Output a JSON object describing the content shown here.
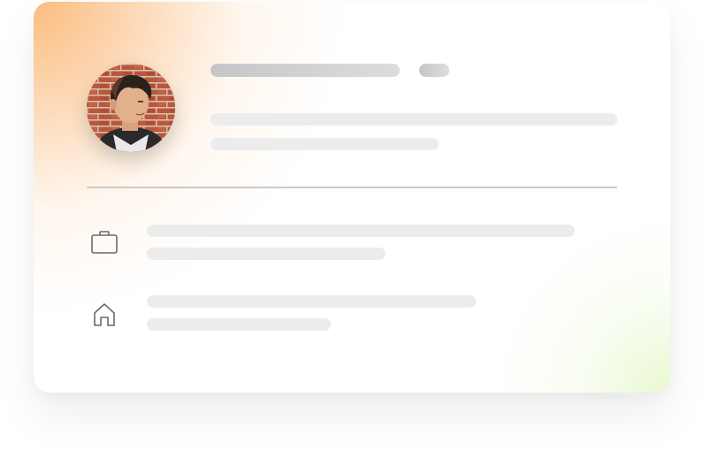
{
  "profile": {
    "avatar": "profile-photo",
    "skeleton_style": "loading-placeholder"
  },
  "details": [
    {
      "icon": "briefcase-icon"
    },
    {
      "icon": "home-icon"
    }
  ]
}
